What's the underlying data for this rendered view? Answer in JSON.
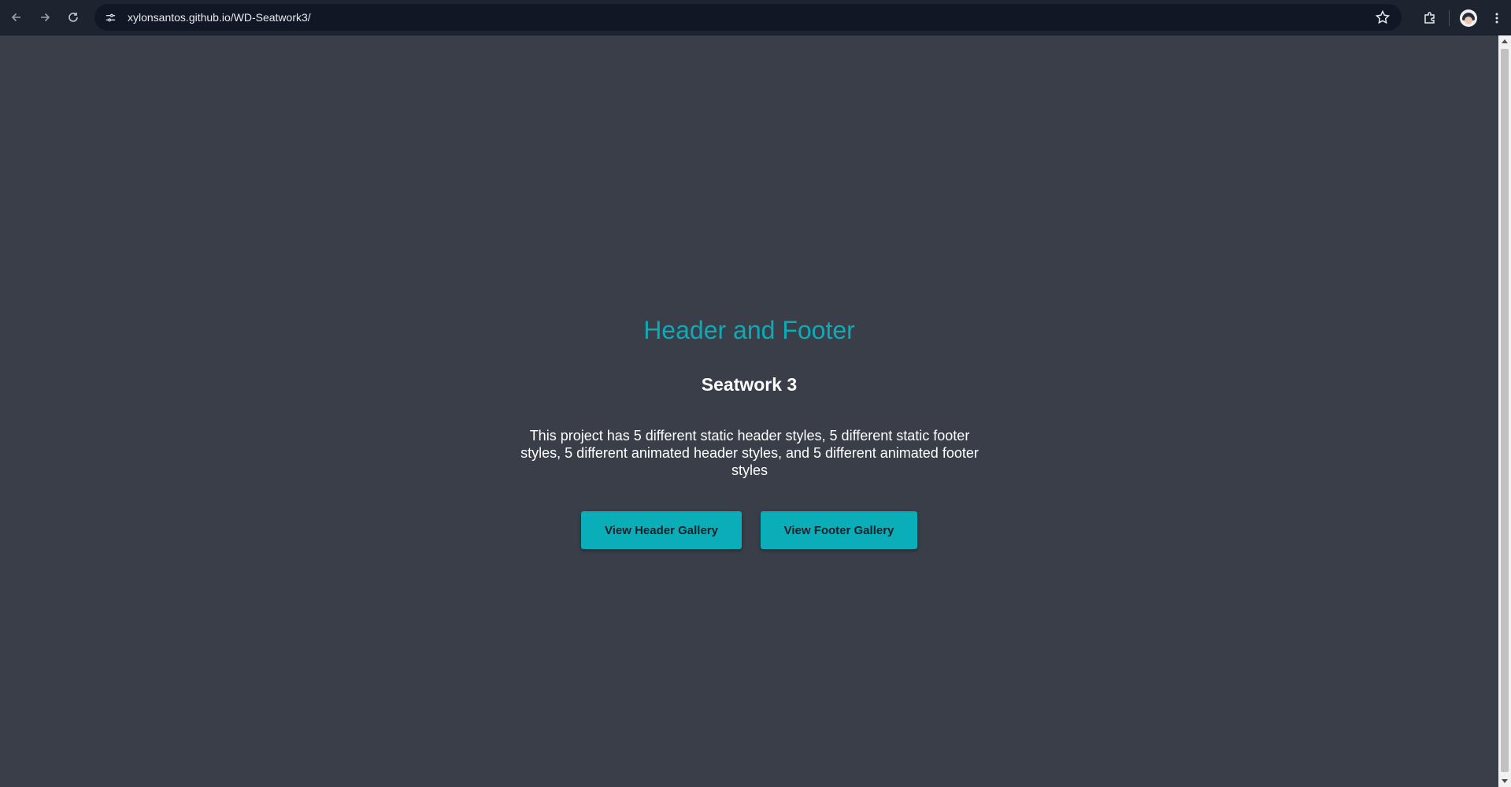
{
  "browser": {
    "url": "xylonsantos.github.io/WD-Seatwork3/",
    "icons": {
      "back": "arrow-left-icon",
      "forward": "arrow-right-icon",
      "reload": "reload-icon",
      "site_info": "tune-icon",
      "bookmark": "star-icon",
      "extensions": "puzzle-icon",
      "menu": "kebab-menu-icon"
    }
  },
  "page": {
    "title": "Header and Footer",
    "subtitle": "Seatwork 3",
    "description": "This project has 5 different static header styles, 5 different static footer styles, 5 different animated header styles, and 5 different animated footer styles",
    "buttons": {
      "header_gallery": "View Header Gallery",
      "footer_gallery": "View Footer Gallery"
    }
  },
  "colors": {
    "background": "#393e48",
    "accent": "#0aaeb8",
    "title": "#0eaab5",
    "text": "#ffffff",
    "browser_bar": "#1e2330"
  }
}
